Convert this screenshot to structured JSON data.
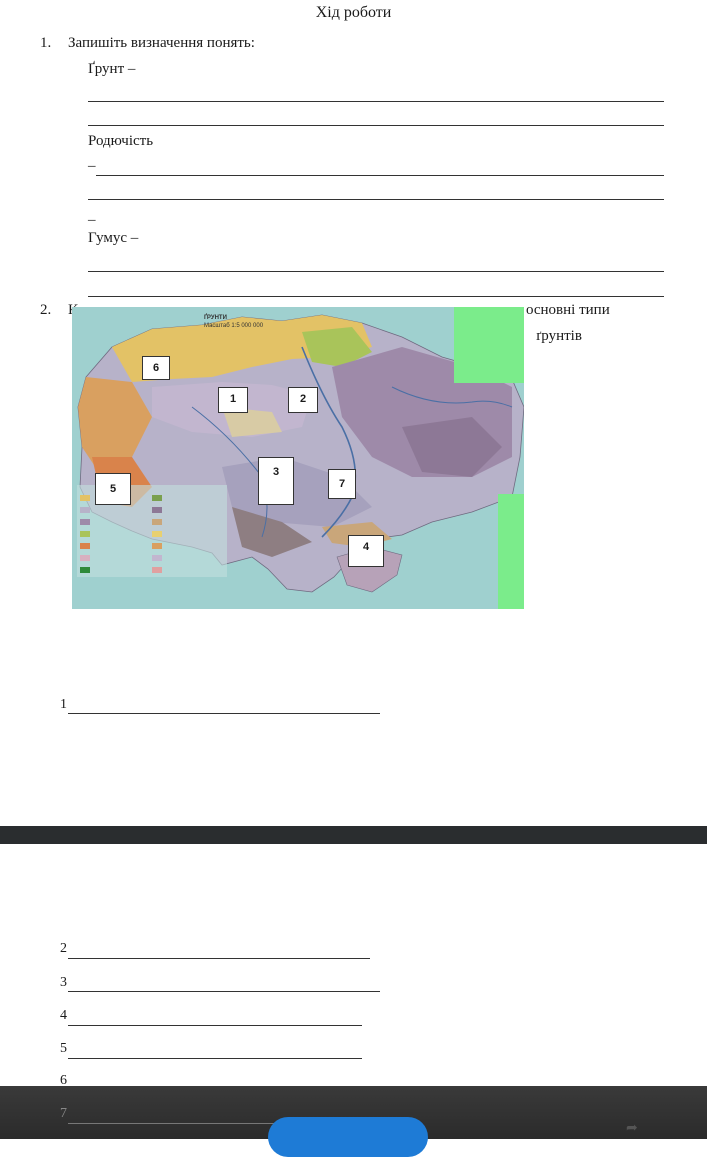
{
  "title": "Хід роботи",
  "task1": {
    "number": "1.",
    "text": "Запишіть визначення понять:",
    "terms": [
      {
        "label": "Ґрунт –"
      },
      {
        "label": "Родючість"
      },
      {
        "label": "Гумус –"
      }
    ],
    "dash_marks": [
      "–",
      "–"
    ]
  },
  "task2": {
    "number": "2.",
    "text_part1": "К",
    "text_right": "основні типи",
    "text_right2": "ґрунтів"
  },
  "map": {
    "heading": "ҐРУНТИ",
    "scale": "Масштаб 1:5 000 000",
    "labels": [
      "1",
      "2",
      "3",
      "4",
      "5",
      "6",
      "7"
    ]
  },
  "answers": [
    {
      "num": "1"
    },
    {
      "num": "2"
    },
    {
      "num": "3"
    },
    {
      "num": "4"
    },
    {
      "num": "5"
    },
    {
      "num": "6"
    },
    {
      "num": "7"
    }
  ],
  "colors": {
    "green_overlay": "#7bec8b",
    "map_sea": "#8fc9c9",
    "button": "#1e7bd6",
    "dark_band": "#2a2d2f"
  }
}
